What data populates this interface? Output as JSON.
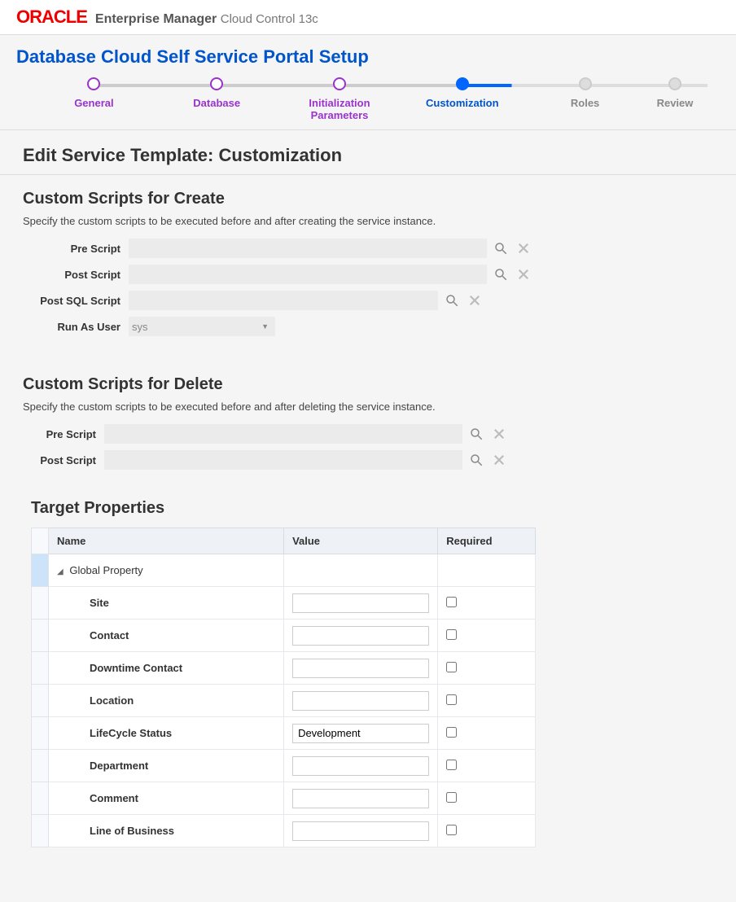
{
  "header": {
    "logo": "ORACLE",
    "title": "Enterprise Manager",
    "subtitle": "Cloud Control 13c"
  },
  "page_title": "Database Cloud Self Service Portal Setup",
  "train": [
    {
      "label": "General",
      "state": "visited"
    },
    {
      "label": "Database",
      "state": "visited"
    },
    {
      "label": "Initialization\nParameters",
      "state": "visited"
    },
    {
      "label": "Customization",
      "state": "current"
    },
    {
      "label": "Roles",
      "state": "unvisited"
    },
    {
      "label": "Review",
      "state": "unvisited"
    }
  ],
  "main_heading": "Edit Service Template: Customization",
  "create_section": {
    "title": "Custom Scripts for Create",
    "desc": "Specify the custom scripts to be executed before and after creating the service instance.",
    "pre_label": "Pre Script",
    "post_label": "Post Script",
    "postsql_label": "Post SQL Script",
    "runas_label": "Run As User",
    "runas_value": "sys",
    "pre_value": "",
    "post_value": "",
    "postsql_value": ""
  },
  "delete_section": {
    "title": "Custom Scripts for Delete",
    "desc": "Specify the custom scripts to be executed before and after deleting the service instance.",
    "pre_label": "Pre Script",
    "post_label": "Post Script",
    "pre_value": "",
    "post_value": ""
  },
  "target_props": {
    "title": "Target Properties",
    "columns": {
      "name": "Name",
      "value": "Value",
      "required": "Required"
    },
    "group_label": "Global Property",
    "rows": [
      {
        "name": "Site",
        "value": "",
        "required": false
      },
      {
        "name": "Contact",
        "value": "",
        "required": false
      },
      {
        "name": "Downtime Contact",
        "value": "",
        "required": false
      },
      {
        "name": "Location",
        "value": "",
        "required": false
      },
      {
        "name": "LifeCycle Status",
        "value": "Development",
        "required": false
      },
      {
        "name": "Department",
        "value": "",
        "required": false
      },
      {
        "name": "Comment",
        "value": "",
        "required": false
      },
      {
        "name": "Line of Business",
        "value": "",
        "required": false
      }
    ]
  }
}
